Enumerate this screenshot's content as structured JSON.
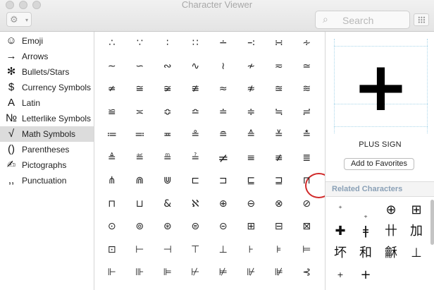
{
  "window": {
    "title": "Character Viewer"
  },
  "toolbar": {
    "gear_caret": "▾",
    "search_placeholder": "Search"
  },
  "sidebar": {
    "items": [
      {
        "icon": "☺",
        "label": "Emoji"
      },
      {
        "icon": "→",
        "label": "Arrows"
      },
      {
        "icon": "✻",
        "label": "Bullets/Stars"
      },
      {
        "icon": "$",
        "label": "Currency Symbols"
      },
      {
        "icon": "A",
        "label": "Latin"
      },
      {
        "icon": "№",
        "label": "Letterlike Symbols"
      },
      {
        "icon": "√",
        "label": "Math Symbols"
      },
      {
        "icon": "()",
        "label": "Parentheses"
      },
      {
        "icon": "✍",
        "label": "Pictographs"
      },
      {
        "icon": ",,",
        "label": "Punctuation"
      }
    ],
    "selected": "Math Symbols"
  },
  "characters": {
    "rows": [
      [
        "∴",
        "∵",
        "∶",
        "∷",
        "∸",
        "∹",
        "∺",
        "∻"
      ],
      [
        "∼",
        "∽",
        "∾",
        "∿",
        "≀",
        "≁",
        "≂",
        "≃"
      ],
      [
        "≄",
        "≅",
        "≆",
        "≇",
        "≈",
        "≉",
        "≊",
        "≋"
      ],
      [
        "≌",
        "≍",
        "≎",
        "≏",
        "≐",
        "≑",
        "≒",
        "≓"
      ],
      [
        "≔",
        "≕",
        "≖",
        "≗",
        "≘",
        "≙",
        "≚",
        "≛"
      ],
      [
        "≜",
        "≝",
        "≞",
        "≟",
        "≠",
        "≡",
        "≢",
        "≣"
      ],
      [
        "⋔",
        "⋒",
        "⋓",
        "⊏",
        "⊐",
        "⊑",
        "⊒",
        "⊓"
      ],
      [
        "⊓",
        "⊔",
        "&",
        "ℵ",
        "⊕",
        "⊖",
        "⊗",
        "⊘"
      ],
      [
        "⊙",
        "⊚",
        "⊛",
        "⊜",
        "⊝",
        "⊞",
        "⊟",
        "⊠"
      ],
      [
        "⊡",
        "⊢",
        "⊣",
        "⊤",
        "⊥",
        "⊦",
        "⊧",
        "⊨"
      ],
      [
        "⊩",
        "⊪",
        "⊫",
        "⊬",
        "⊭",
        "⊮",
        "⊯",
        "⊰"
      ]
    ],
    "selected_char": "≠"
  },
  "detail": {
    "glyph": "+",
    "name": "PLUS SIGN",
    "favorites_label": "Add to Favorites",
    "related_header": "Related Characters",
    "related": [
      "⁺",
      "₊",
      "⊕",
      "⊞",
      "✚",
      "ǂ",
      "卄",
      "加",
      "坏",
      "和",
      "龢",
      "⊥",
      "+",
      "+"
    ]
  }
}
